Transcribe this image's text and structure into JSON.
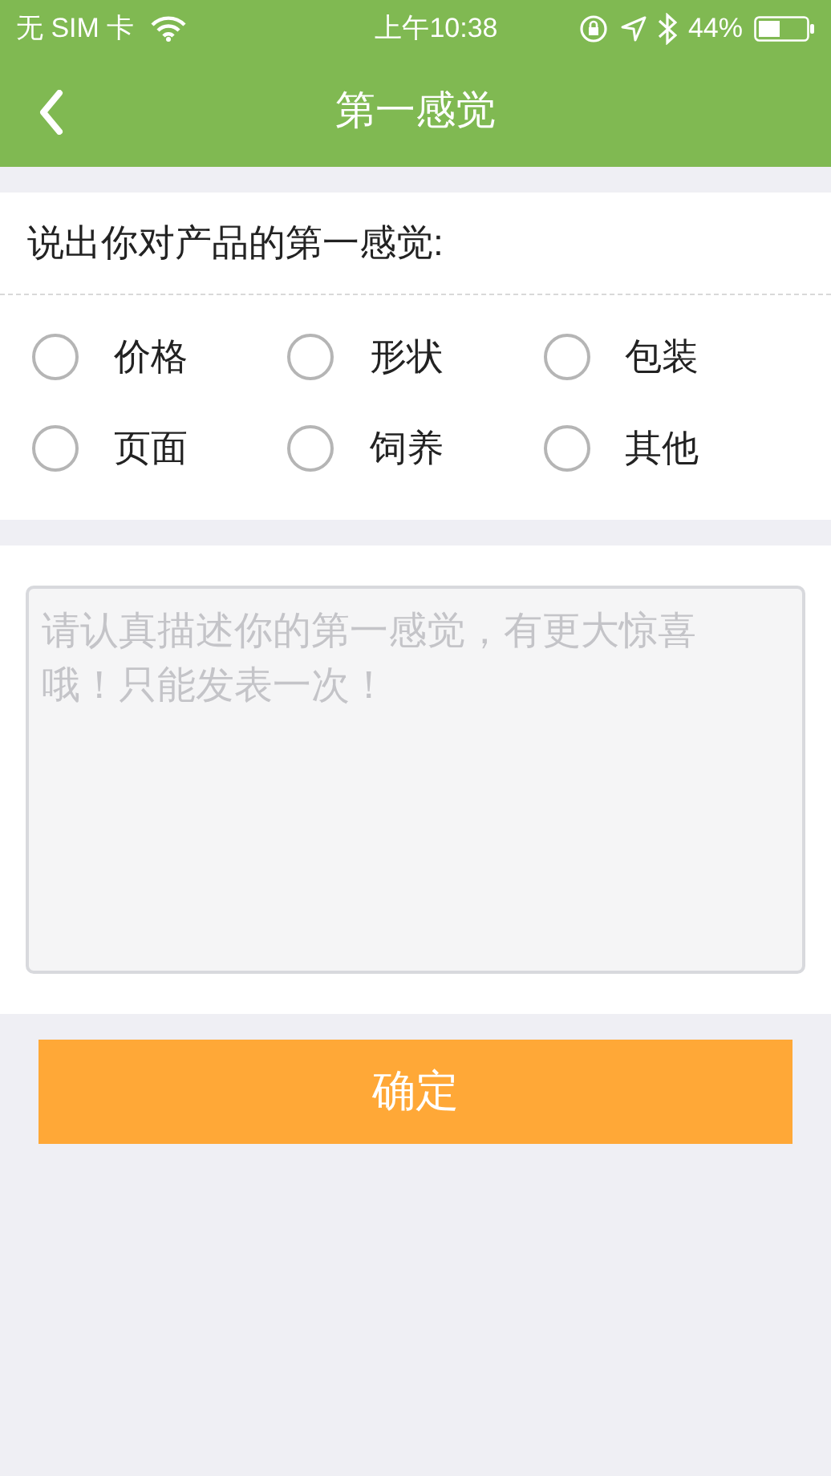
{
  "status_bar": {
    "carrier": "无 SIM 卡",
    "time": "上午10:38",
    "battery": "44%"
  },
  "nav_bar": {
    "title": "第一感觉"
  },
  "question": "说出你对产品的第一感觉:",
  "options": [
    {
      "label": "价格",
      "selected": false
    },
    {
      "label": "形状",
      "selected": false
    },
    {
      "label": "包装",
      "selected": false
    },
    {
      "label": "页面",
      "selected": false
    },
    {
      "label": "饲养",
      "selected": false
    },
    {
      "label": "其他",
      "selected": false
    }
  ],
  "comment": {
    "placeholder": "请认真描述你的第一感觉，有更大惊喜哦！只能发表一次！"
  },
  "submit_button": "确定"
}
